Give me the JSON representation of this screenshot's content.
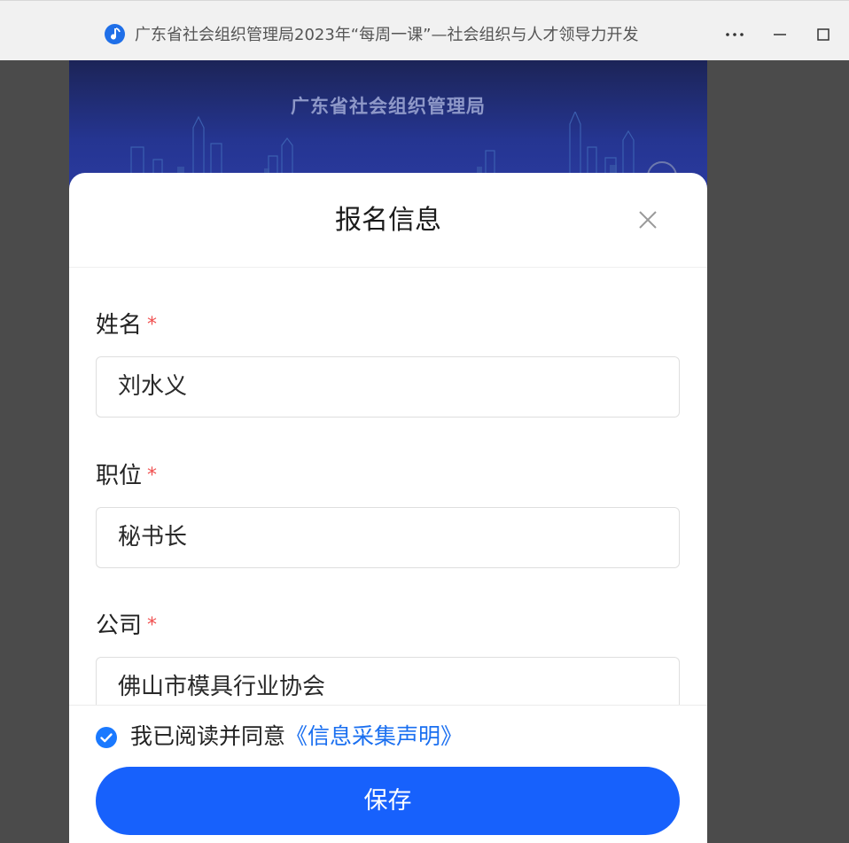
{
  "window": {
    "title": "广东省社会组织管理局2023年“每周一课”—社会组织与人才领导力开发",
    "icon": "music-note-icon",
    "controls": [
      "more-icon",
      "minimize-icon",
      "maximize-icon"
    ]
  },
  "banner": {
    "title": "广东省社会组织管理局"
  },
  "sheet": {
    "title": "报名信息",
    "required_mark": "*",
    "fields": [
      {
        "label": "姓名",
        "value": "刘水义"
      },
      {
        "label": "职位",
        "value": "秘书长"
      },
      {
        "label": "公司",
        "value": "佛山市模具行业协会"
      }
    ],
    "agreement": {
      "checked": true,
      "text": "我已阅读并同意",
      "link": "《信息采集声明》"
    },
    "save_label": "保存"
  },
  "colors": {
    "primary": "#1761fc",
    "link": "#1a6ff0",
    "required": "#f05050",
    "banner": "#253591"
  }
}
